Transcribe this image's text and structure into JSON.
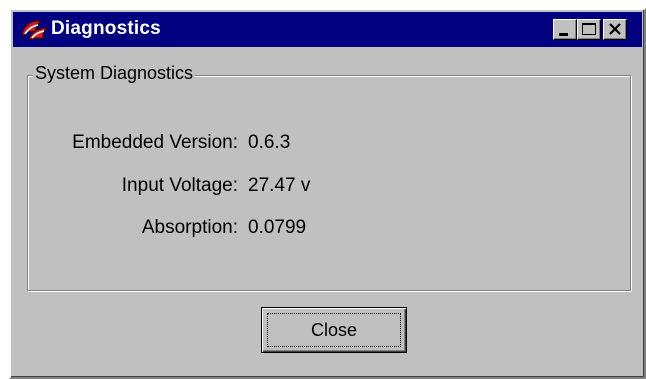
{
  "window": {
    "title": "Diagnostics",
    "icon": "app-logo-icon",
    "controls": {
      "minimize": "minimize-icon",
      "maximize": "maximize-icon",
      "close": "close-icon"
    }
  },
  "group": {
    "label": "System Diagnostics",
    "rows": [
      {
        "label": "Embedded Version:",
        "value": "0.6.3"
      },
      {
        "label": "Input Voltage:",
        "value": "27.47 v"
      },
      {
        "label": "Absorption:",
        "value": "0.0799"
      }
    ]
  },
  "buttons": {
    "close_label": "Close"
  },
  "colors": {
    "titlebar": "#000080",
    "face": "#c0c0c0",
    "icon_red": "#cc1010"
  }
}
